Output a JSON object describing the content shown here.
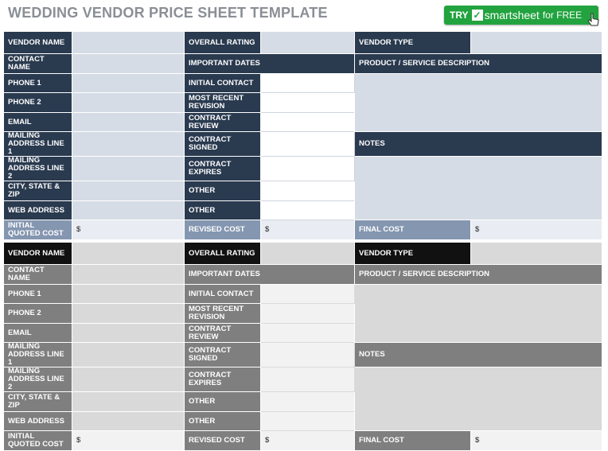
{
  "title": "WEDDING VENDOR PRICE SHEET TEMPLATE",
  "cta": {
    "try": "TRY",
    "check": "✓",
    "brand": "smartsheet",
    "free": "for FREE"
  },
  "labels": {
    "vendor_name": "VENDOR NAME",
    "overall_rating": "OVERALL RATING",
    "vendor_type": "VENDOR TYPE",
    "contact_name": "CONTACT NAME",
    "important_dates": "IMPORTANT DATES",
    "product_desc": "PRODUCT / SERVICE DESCRIPTION",
    "phone1": "PHONE 1",
    "initial_contact": "INITIAL CONTACT",
    "phone2": "PHONE 2",
    "most_recent_revision": "MOST RECENT REVISION",
    "email": "EMAIL",
    "contract_review": "CONTRACT REVIEW",
    "mailing1": "MAILING ADDRESS LINE 1",
    "contract_signed": "CONTRACT SIGNED",
    "notes": "NOTES",
    "mailing2": "MAILING ADDRESS LINE 2",
    "contract_expires": "CONTRACT EXPIRES",
    "city": "CITY, STATE & ZIP",
    "other": "OTHER",
    "web": "WEB ADDRESS",
    "initial_cost": "INITIAL QUOTED COST",
    "revised_cost": "REVISED COST",
    "final_cost": "FINAL COST",
    "currency": "$"
  }
}
